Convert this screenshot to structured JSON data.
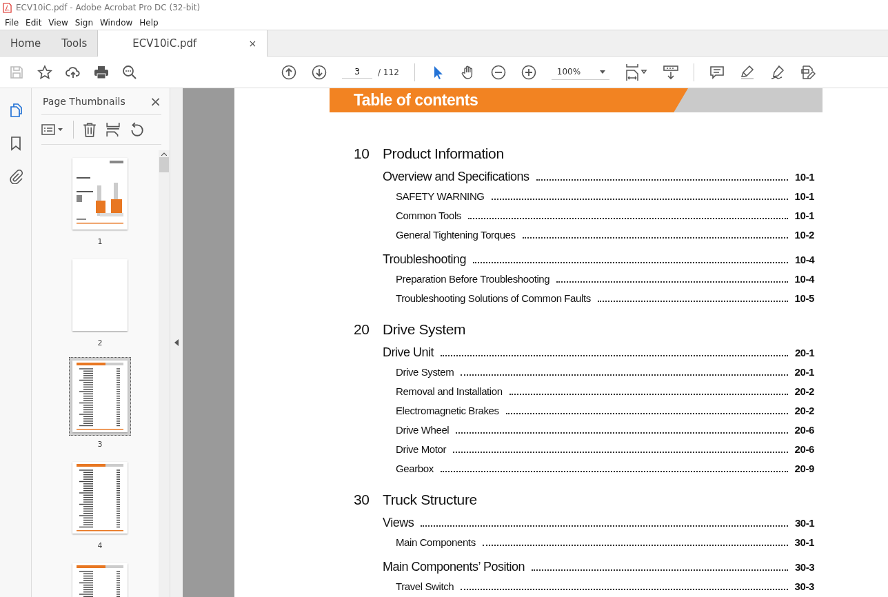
{
  "window": {
    "title": "ECV10iC.pdf - Adobe Acrobat Pro DC (32-bit)"
  },
  "menu": [
    "File",
    "Edit",
    "View",
    "Sign",
    "Window",
    "Help"
  ],
  "tabs": [
    {
      "label": "Home",
      "selected": false
    },
    {
      "label": "Tools",
      "selected": false
    },
    {
      "label": "ECV10iC.pdf",
      "selected": true,
      "close": "×"
    }
  ],
  "toolbar": {
    "page": "3",
    "page_count": "/ 112",
    "zoom": "100%"
  },
  "rail": [
    {
      "kind": "pages",
      "selected": true
    },
    {
      "kind": "bookmark",
      "selected": false
    },
    {
      "kind": "attach",
      "selected": false
    }
  ],
  "panel": {
    "title": "Page Thumbnails",
    "close": "×",
    "thumbnails": [
      {
        "label": "1",
        "kind": "cover",
        "selected": false
      },
      {
        "label": "2",
        "kind": "blank",
        "selected": false
      },
      {
        "label": "3",
        "kind": "toc",
        "selected": true
      },
      {
        "label": "4",
        "kind": "toc",
        "selected": false
      },
      {
        "kind": "toc",
        "selected": false
      }
    ]
  },
  "document": {
    "heading": "Table of contents",
    "entries": [
      {
        "kind": "chapter",
        "number": "10",
        "title": "Product Information"
      },
      {
        "kind": "section",
        "title": "Overview and Specifications",
        "page": "10-1"
      },
      {
        "kind": "item",
        "title": "SAFETY WARNING",
        "page": "10-1"
      },
      {
        "kind": "item",
        "title": "Common Tools",
        "page": "10-1"
      },
      {
        "kind": "item",
        "title": "General Tightening Torques",
        "page": "10-2"
      },
      {
        "kind": "section",
        "title": "Troubleshooting",
        "page": "10-4"
      },
      {
        "kind": "item",
        "title": "Preparation Before Troubleshooting",
        "page": "10-4"
      },
      {
        "kind": "item",
        "title": "Troubleshooting Solutions of Common Faults",
        "page": "10-5"
      },
      {
        "kind": "chapter",
        "number": "20",
        "title": "Drive System"
      },
      {
        "kind": "section",
        "title": "Drive Unit",
        "page": "20-1"
      },
      {
        "kind": "item",
        "title": "Drive System",
        "page": "20-1"
      },
      {
        "kind": "item",
        "title": "Removal and Installation",
        "page": "20-2"
      },
      {
        "kind": "item",
        "title": "Electromagnetic Brakes",
        "page": "20-2"
      },
      {
        "kind": "item",
        "title": "Drive Wheel",
        "page": "20-6"
      },
      {
        "kind": "item",
        "title": "Drive Motor",
        "page": "20-6"
      },
      {
        "kind": "item",
        "title": "Gearbox",
        "page": "20-9"
      },
      {
        "kind": "chapter",
        "number": "30",
        "title": "Truck Structure"
      },
      {
        "kind": "section",
        "title": "Views",
        "page": "30-1"
      },
      {
        "kind": "item",
        "title": "Main Components",
        "page": "30-1"
      },
      {
        "kind": "section",
        "title": "Main Components’ Position",
        "page": "30-3"
      },
      {
        "kind": "item",
        "title": "Travel Switch",
        "page": "30-3"
      }
    ]
  }
}
